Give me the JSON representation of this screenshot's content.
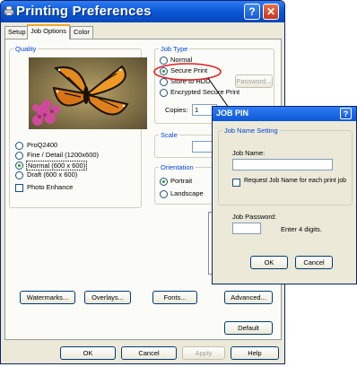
{
  "window": {
    "title": "Printing Preferences",
    "help_glyph": "?",
    "close_glyph": "✕"
  },
  "tabs": [
    {
      "label": "Setup",
      "active": false
    },
    {
      "label": "Job Options",
      "active": true
    },
    {
      "label": "Color",
      "active": false
    }
  ],
  "quality": {
    "legend": "Quality",
    "options": [
      {
        "label": "ProQ2400",
        "selected": false
      },
      {
        "label": "Fine / Detail (1200x600)",
        "selected": false
      },
      {
        "label": "Normal (600 x 600)",
        "selected": true
      },
      {
        "label": "Draft (600 x 600)",
        "selected": false
      }
    ],
    "photo_enhance": {
      "label": "Photo Enhance",
      "checked": false
    }
  },
  "job_type": {
    "legend": "Job Type",
    "options": [
      {
        "label": "Normal",
        "selected": false
      },
      {
        "label": "Secure Print",
        "selected": true
      },
      {
        "label": "Store to HDD",
        "selected": false
      },
      {
        "label": "Encrypted Secure Print",
        "selected": false
      }
    ],
    "password_button": "Password...",
    "copies_label": "Copies:",
    "copies_value": "1"
  },
  "scale": {
    "legend": "Scale",
    "value": "100"
  },
  "orientation": {
    "legend": "Orientation",
    "options": [
      {
        "label": "Portrait",
        "selected": true
      },
      {
        "label": "Landscape",
        "selected": false
      }
    ]
  },
  "buttons": {
    "watermarks": "Watermarks...",
    "overlays": "Overlays...",
    "fonts": "Fonts...",
    "advanced": "Advanced...",
    "default": "Default",
    "ok": "OK",
    "cancel": "Cancel",
    "apply": "Apply",
    "help": "Help"
  },
  "job_pin": {
    "title": "JOB PIN",
    "group_legend": "Job Name Setting",
    "job_name_label": "Job Name:",
    "job_name_value": "",
    "request_label": "Request Job Name for each print job",
    "request_checked": false,
    "password_label": "Job Password:",
    "password_value": "",
    "digits_hint": "Enter 4 digits.",
    "ok": "OK",
    "cancel": "Cancel"
  },
  "colors": {
    "title_bar": "#0a58d6",
    "highlight_ellipse": "#e02020",
    "tab_accent": "#f5a623"
  }
}
